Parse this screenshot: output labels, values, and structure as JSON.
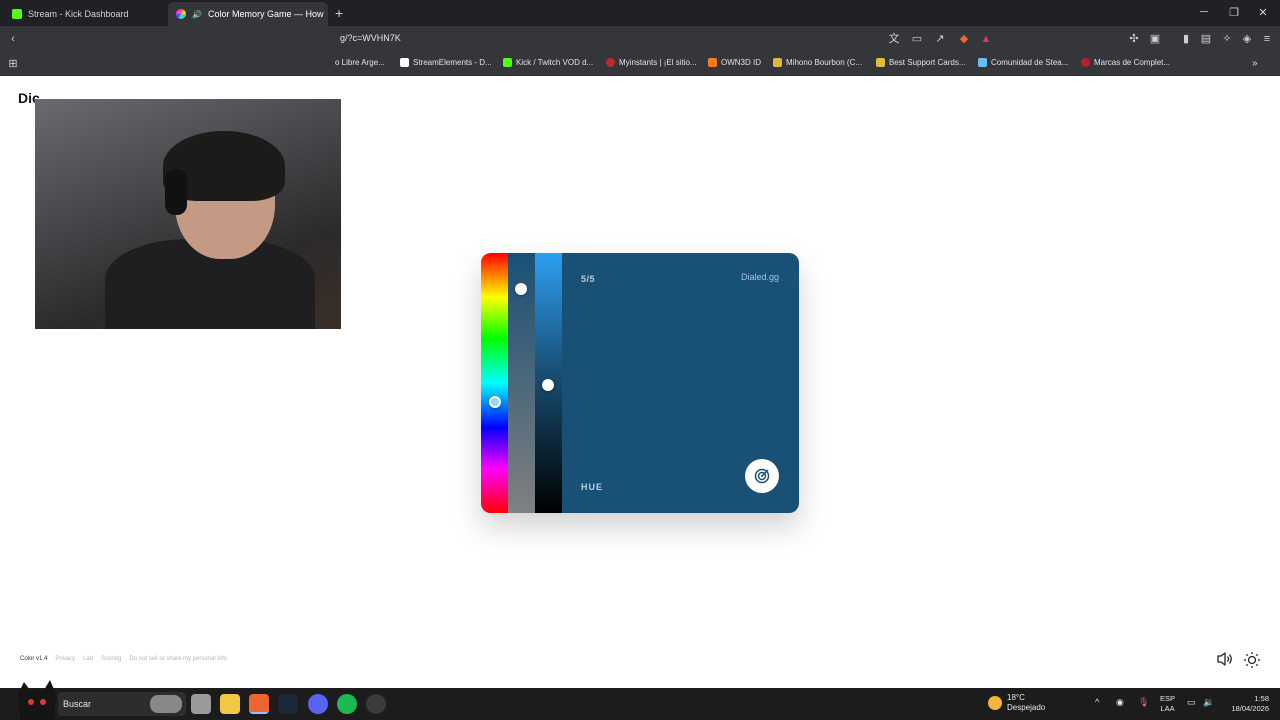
{
  "browser": {
    "tabs": [
      {
        "title": "Stream - Kick Dashboard",
        "favicon_color": "#53fc18"
      },
      {
        "title": "Color Memory Game — How",
        "favicon_color": "#c04cc6",
        "active": true
      }
    ],
    "new_tab_icon": "plus-icon",
    "url": "g/?c=WVHN7K",
    "bookmarks": [
      {
        "label": "o Libre Arge...",
        "color": "#3c3c3c"
      },
      {
        "label": "StreamElements - D...",
        "color": "#ffffff"
      },
      {
        "label": "Kick / Twitch VOD d...",
        "color": "#53fc18"
      },
      {
        "label": "Myinstants | ¡El sitio...",
        "color": "#c0282d"
      },
      {
        "label": "OWN3D ID",
        "color": "#ff7a1a"
      },
      {
        "label": "Mihono Bourbon (C...",
        "color": "#e0b84a"
      },
      {
        "label": "Best Support Cards...",
        "color": "#d8c03c"
      },
      {
        "label": "Comunidad de Stea...",
        "color": "#66c0f4"
      },
      {
        "label": "Marcas de Complet...",
        "color": "#b8202a"
      }
    ],
    "bookmarks_overflow": "»"
  },
  "page": {
    "site_logo": "Dic",
    "webcam": {
      "note": "webcam-overlay"
    },
    "game": {
      "round": "5/5",
      "brand": "Dialed.gg",
      "mode": "HUE",
      "current_color": "#195076",
      "hue_position": 0.57,
      "saturation_position": 0.14,
      "brightness_position": 0.51
    },
    "footer": {
      "version": "Color v1.4",
      "links": [
        "Privacy",
        "Lab",
        "Scoring",
        "Do not sell or share my personal info"
      ]
    }
  },
  "taskbar": {
    "search_label": "Buscar",
    "weather": {
      "temp": "18°C",
      "condition": "Despejado"
    },
    "lang": {
      "line1": "ESP",
      "line2": "LAA"
    },
    "clock": {
      "time": "1:58",
      "date": "18/04/2026"
    }
  }
}
